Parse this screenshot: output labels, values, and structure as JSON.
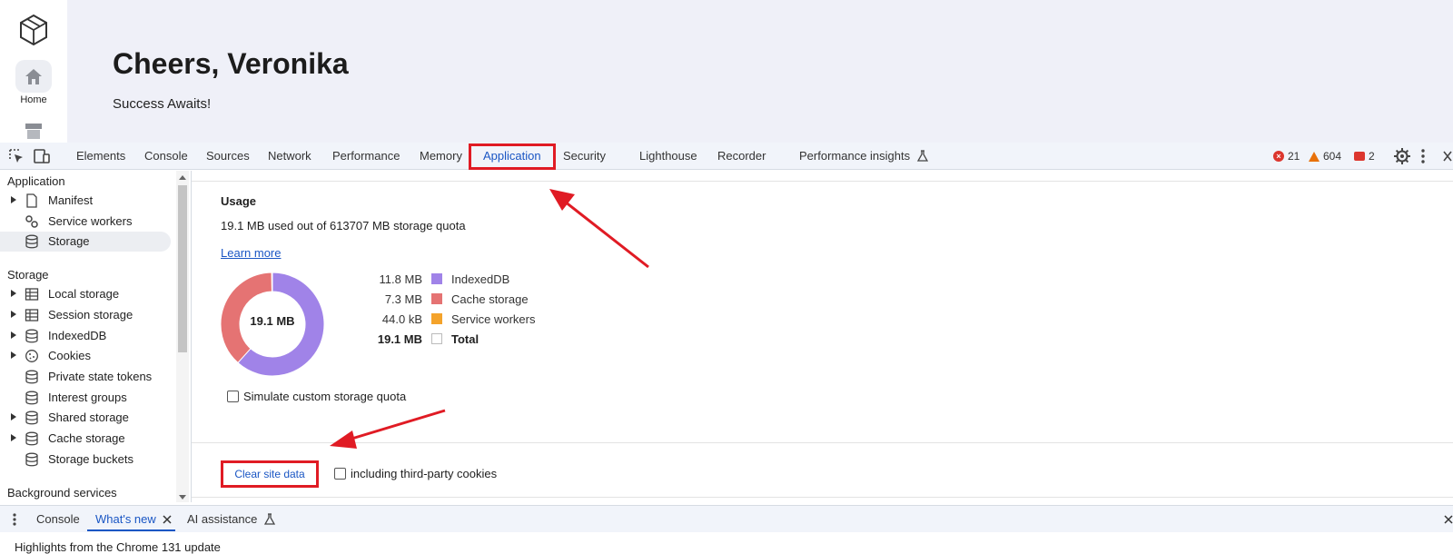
{
  "app": {
    "greeting": "Cheers, Veronika",
    "subtitle": "Success Awaits!",
    "rail": {
      "home_label": "Home",
      "logo_icon": "cube-logo-icon",
      "store_icon": "store-icon"
    }
  },
  "devtools": {
    "tabs": [
      {
        "label": "Elements"
      },
      {
        "label": "Console"
      },
      {
        "label": "Sources"
      },
      {
        "label": "Network"
      },
      {
        "label": "Performance"
      },
      {
        "label": "Memory"
      },
      {
        "label": "Application",
        "active": true
      },
      {
        "label": "Security"
      },
      {
        "label": "Lighthouse"
      },
      {
        "label": "Recorder"
      },
      {
        "label": "Performance insights"
      }
    ],
    "counts": {
      "errors": "21",
      "warnings": "604",
      "issues": "2"
    },
    "accent_color": "#1a56c4",
    "annotation_color": "#e01b24"
  },
  "sidebar": {
    "application_header": "Application",
    "application_items": [
      {
        "label": "Manifest",
        "icon": "file-icon"
      },
      {
        "label": "Service workers",
        "icon": "gears-icon"
      },
      {
        "label": "Storage",
        "icon": "database-icon",
        "selected": true
      }
    ],
    "storage_header": "Storage",
    "storage_items": [
      {
        "label": "Local storage",
        "icon": "table-icon"
      },
      {
        "label": "Session storage",
        "icon": "table-icon"
      },
      {
        "label": "IndexedDB",
        "icon": "database-icon"
      },
      {
        "label": "Cookies",
        "icon": "cookie-icon"
      },
      {
        "label": "Private state tokens",
        "icon": "database-icon"
      },
      {
        "label": "Interest groups",
        "icon": "database-icon"
      },
      {
        "label": "Shared storage",
        "icon": "database-icon"
      },
      {
        "label": "Cache storage",
        "icon": "database-icon"
      },
      {
        "label": "Storage buckets",
        "icon": "database-icon"
      }
    ],
    "background_header": "Background services"
  },
  "usage": {
    "title": "Usage",
    "summary": "19.1 MB used out of 613707 MB storage quota",
    "learn_more": "Learn more",
    "donut_center": "19.1 MB",
    "legend": [
      {
        "value": "11.8 MB",
        "name": "IndexedDB",
        "color": "#a083e8"
      },
      {
        "value": "7.3 MB",
        "name": "Cache storage",
        "color": "#e57373"
      },
      {
        "value": "44.0 kB",
        "name": "Service workers",
        "color": "#f4a32b"
      },
      {
        "value": "19.1 MB",
        "name": "Total",
        "color": "#ffffff",
        "bold": true
      }
    ],
    "simulate_label": "Simulate custom storage quota",
    "clear_button": "Clear site data",
    "third_party_label": "including third-party cookies"
  },
  "drawer": {
    "tabs": [
      {
        "label": "Console"
      },
      {
        "label": "What's new",
        "active": true
      },
      {
        "label": "AI assistance"
      }
    ],
    "content": "Highlights from the Chrome 131 update"
  }
}
